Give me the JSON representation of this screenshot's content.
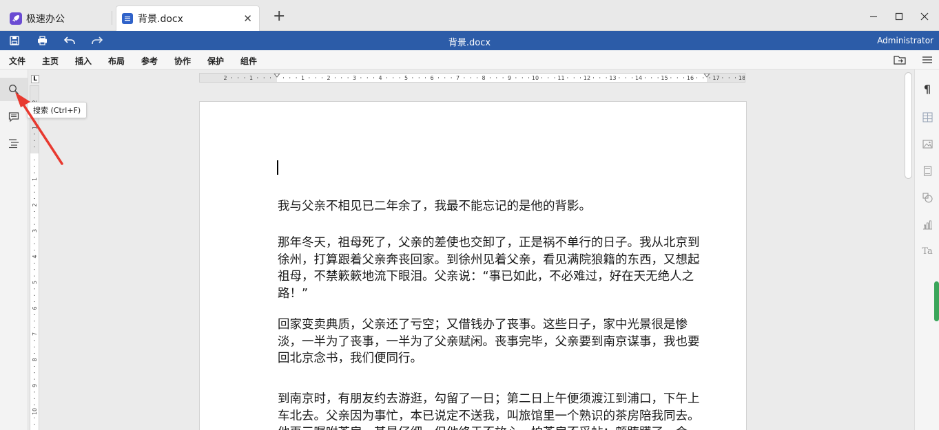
{
  "tabs": [
    {
      "label": "极速办公"
    },
    {
      "label": "背景.docx"
    }
  ],
  "titlebar": {
    "title": "背景.docx",
    "user": "Administrator"
  },
  "menu": {
    "items": [
      "文件",
      "主页",
      "插入",
      "布局",
      "参考",
      "协作",
      "保护",
      "组件"
    ]
  },
  "tooltip": "搜索 (Ctrl+F)",
  "ruler": {
    "corner": "L"
  },
  "document": {
    "paragraphs": [
      "我与父亲不相见已二年余了，我最不能忘记的是他的背影。",
      "那年冬天，祖母死了，父亲的差使也交卸了，正是祸不单行的日子。我从北京到徐州，打算跟着父亲奔丧回家。到徐州见着父亲，看见满院狼籍的东西，又想起祖母，不禁簌簌地流下眼泪。父亲说：“事已如此，不必难过，好在天无绝人之路！”",
      "回家变卖典质，父亲还了亏空；又借钱办了丧事。这些日子，家中光景很是惨淡，一半为了丧事，一半为了父亲赋闲。丧事完毕，父亲要到南京谋事，我也要回北京念书，我们便同行。",
      "到南京时，有朋友约去游逛，勾留了一日；第二日上午便须渡江到浦口，下午上车北去。父亲因为事忙，本已说定不送我，叫旅馆里一个熟识的茶房陪我同去。他再三嘱咐茶房，甚是仔细。但他终于不放心，怕茶房不妥帖；颇踌躇了一会。"
    ]
  },
  "colors": {
    "titlebar": "#2c5ca8",
    "app_logo": "#6a4bd3",
    "doc_logo": "#2f62c9",
    "annotation": "#e8392f",
    "panel_handle": "#3aa55a"
  }
}
